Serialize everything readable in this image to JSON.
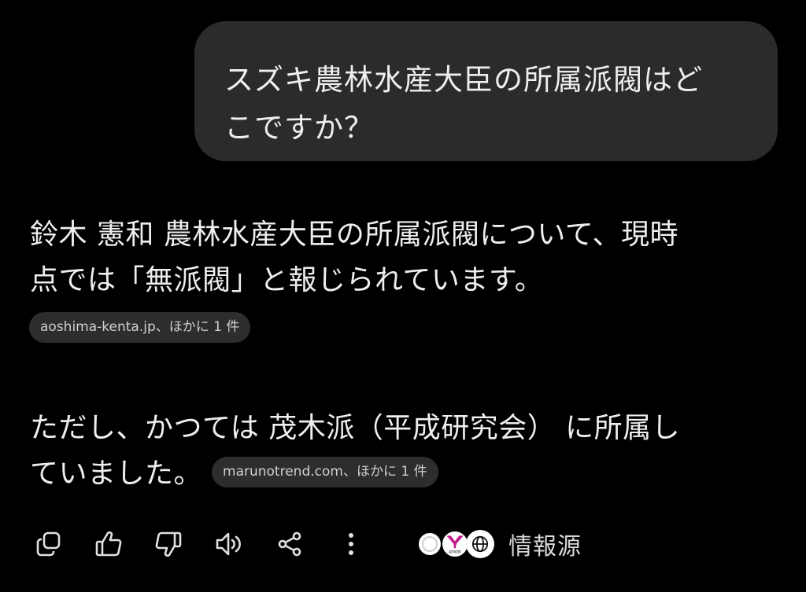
{
  "user_message": {
    "line1": "スズキ農林水産大臣の所属派閥はど",
    "line2": "こですか？"
  },
  "answer": {
    "paragraph1": {
      "line1": "鈴木 憲和 農林水産大臣の所属派閥について、現時",
      "line2": "点では「無派閥」と報じられています。",
      "source_chip": "aoshima-kenta.jp、ほかに 1 件"
    },
    "paragraph2": {
      "line1": "ただし、かつては 茂木派（平成研究会） に所属し",
      "line2": "ていました。",
      "source_chip": "marunotrend.com、ほかに 1 件"
    }
  },
  "actions": {
    "icons": [
      "copy-icon",
      "thumbs-up-icon",
      "thumbs-down-icon",
      "speaker-icon",
      "share-icon",
      "more-vertical-icon"
    ],
    "sources_label": "情報源",
    "favicon_anon_text": "anon"
  },
  "colors": {
    "background": "#000000",
    "bubble": "#2b2b2d",
    "chip": "#2d2d2f",
    "text": "#eeeeee",
    "anon_magenta": "#c2188a"
  }
}
